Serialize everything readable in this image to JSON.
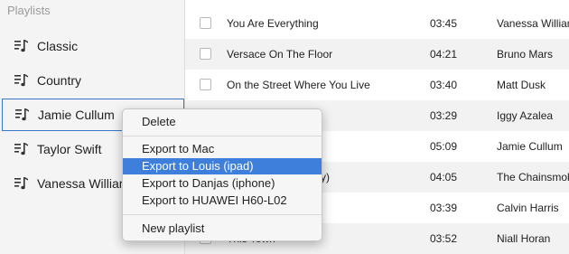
{
  "sidebar": {
    "header": "Playlists",
    "items": [
      {
        "label": "Classic"
      },
      {
        "label": "Country"
      },
      {
        "label": "Jamie Cullum",
        "selected": true
      },
      {
        "label": "Taylor Swift"
      },
      {
        "label": "Vanessa Williams"
      }
    ]
  },
  "songs": [
    {
      "title": "You Are Everything",
      "time": "03:45",
      "artist": "Vanessa Williams"
    },
    {
      "title": "Versace On The Floor",
      "time": "04:21",
      "artist": "Bruno Mars"
    },
    {
      "title": "On the Street Where You Live",
      "time": "03:40",
      "artist": "Matt Dusk"
    },
    {
      "title": "",
      "time": "03:29",
      "artist": "Iggy Azalea"
    },
    {
      "title": "",
      "time": "05:09",
      "artist": "Jamie Cullum"
    },
    {
      "title": "y)",
      "time": "04:05",
      "artist": "The Chainsmokers"
    },
    {
      "title": "",
      "time": "03:39",
      "artist": "Calvin Harris"
    },
    {
      "title": "This Town",
      "time": "03:52",
      "artist": "Niall Horan"
    }
  ],
  "context_menu": {
    "delete": "Delete",
    "export_mac": "Export to Mac",
    "export_louis": "Export to Louis (ipad)",
    "export_danjas": "Export to Danjas (iphone)",
    "export_huawei": "Export to HUAWEI H60-L02",
    "new_playlist": "New playlist"
  },
  "colors": {
    "selection_border": "#3a76c9",
    "menu_highlight": "#3d7fdb",
    "sidebar_bg": "#f4f4f4",
    "row_alt_bg": "#f2f2f2"
  },
  "icons": {
    "playlist": "music-list-icon",
    "checkbox": "checkbox-icon"
  }
}
